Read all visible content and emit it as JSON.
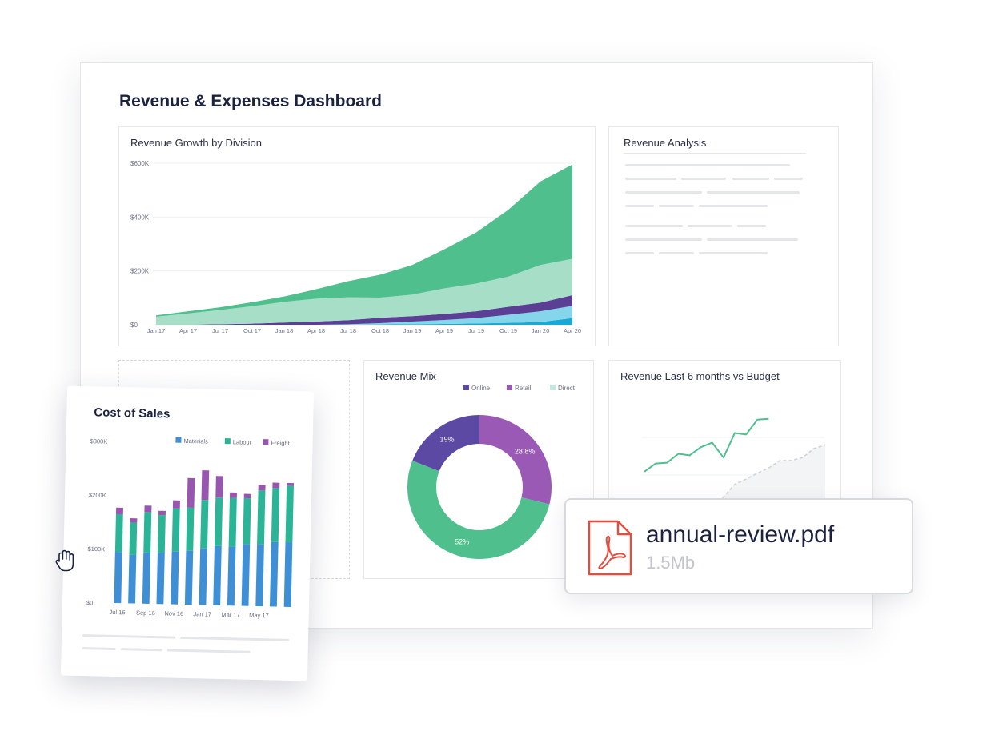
{
  "dashboard": {
    "title": "Revenue & Expenses Dashboard"
  },
  "growth": {
    "title": "Revenue Growth by Division",
    "chart_data": {
      "type": "area",
      "title": "Revenue Growth by Division",
      "x_ticks": [
        "Jan 17",
        "Apr 17",
        "Jul 17",
        "Oct 17",
        "Jan 18",
        "Apr 18",
        "Jul 18",
        "Oct 18",
        "Jan 19",
        "Apr 19",
        "Jul 19",
        "Oct 19",
        "Jan 20",
        "Apr 20"
      ],
      "y_ticks": [
        "$0",
        "$200K",
        "$400K",
        "$600K"
      ],
      "ylim": [
        0,
        600000
      ],
      "x": [
        0,
        3,
        6,
        9,
        12,
        15,
        18,
        21,
        24,
        27,
        30,
        33,
        36,
        39
      ],
      "stacked": true,
      "series": [
        {
          "color": "#1aa9d6",
          "values": [
            0,
            0,
            0,
            0,
            0,
            0,
            0,
            1000,
            2000,
            3000,
            5000,
            7000,
            10000,
            25000
          ]
        },
        {
          "color": "#85d6ea",
          "values": [
            0,
            0,
            0,
            0,
            0,
            0,
            2000,
            5000,
            10000,
            15000,
            20000,
            30000,
            40000,
            45000
          ]
        },
        {
          "color": "#5b3f95",
          "values": [
            0,
            0,
            2000,
            4000,
            8000,
            12000,
            15000,
            20000,
            20000,
            22000,
            25000,
            30000,
            32000,
            40000
          ]
        },
        {
          "color": "#a6dec8",
          "values": [
            30000,
            42000,
            53000,
            65000,
            77000,
            85000,
            85000,
            75000,
            80000,
            95000,
            103000,
            112000,
            140000,
            135000
          ]
        },
        {
          "color": "#4fc08d",
          "values": [
            5000,
            8000,
            10000,
            15000,
            20000,
            35000,
            60000,
            85000,
            110000,
            145000,
            190000,
            248000,
            310000,
            350000
          ]
        }
      ]
    }
  },
  "analysis": {
    "title": "Revenue Analysis"
  },
  "mix": {
    "title": "Revenue Mix",
    "chart_data": {
      "type": "pie",
      "donut": true,
      "title": "Revenue Mix",
      "legend_position": "top-right",
      "categories": [
        "Online",
        "Retail",
        "Direct"
      ],
      "values": [
        19,
        28.8,
        52
      ],
      "labels": [
        "19%",
        "28.8%",
        "52%"
      ],
      "colors": [
        "#5b49a3",
        "#9b59b6",
        "#4fc08d"
      ],
      "legend_colors": [
        "#5b49a3",
        "#9b59b6",
        "#bfe9df"
      ]
    }
  },
  "budget": {
    "title": "Revenue Last 6 months vs Budget",
    "chart_data": {
      "type": "line",
      "title": "Revenue Last 6 months vs Budget",
      "ylim": [
        0,
        100
      ],
      "x": [
        0,
        1,
        2,
        3,
        4,
        5,
        6,
        7,
        8,
        9,
        10,
        11,
        12,
        13,
        14,
        15,
        16
      ],
      "series": [
        {
          "color": "#4fc08d",
          "dashed": false,
          "values": [
            12,
            23,
            24,
            36,
            34,
            45,
            51,
            31,
            64,
            62,
            82,
            83,
            null,
            null,
            null,
            null,
            null
          ]
        },
        {
          "color": "#cfd2d8",
          "dashed": true,
          "values": [
            null,
            null,
            null,
            null,
            null,
            null,
            -30,
            -22,
            -5,
            2,
            10,
            17,
            27,
            27,
            31,
            43,
            48
          ]
        }
      ]
    }
  },
  "cost": {
    "title": "Cost of Sales",
    "chart_data": {
      "type": "bar",
      "stacked": true,
      "title": "Cost of Sales",
      "legend_position": "top-right",
      "y_ticks": [
        "$0",
        "$100K",
        "$200K",
        "$300K"
      ],
      "ylim": [
        0,
        300000
      ],
      "x_ticks": [
        "Jul 16",
        "Sep 16",
        "Nov 16",
        "Jan 17",
        "Mar 17",
        "May 17"
      ],
      "series": [
        {
          "name": "Materials",
          "color": "#3e8fd5",
          "values": [
            95000,
            90000,
            95000,
            95000,
            98000,
            100000,
            105000,
            110000,
            110000,
            115000,
            115000,
            120000,
            120000
          ]
        },
        {
          "name": "Labour",
          "color": "#2bb596",
          "values": [
            70000,
            60000,
            75000,
            70000,
            80000,
            80000,
            90000,
            90000,
            90000,
            85000,
            100000,
            100000,
            105000
          ]
        },
        {
          "name": "Freight",
          "color": "#9856b0",
          "values": [
            12000,
            8000,
            12000,
            8000,
            15000,
            55000,
            55000,
            40000,
            10000,
            8000,
            10000,
            10000,
            5000
          ]
        }
      ]
    }
  },
  "file": {
    "name": "annual-review.pdf",
    "size": "1.5Mb"
  }
}
